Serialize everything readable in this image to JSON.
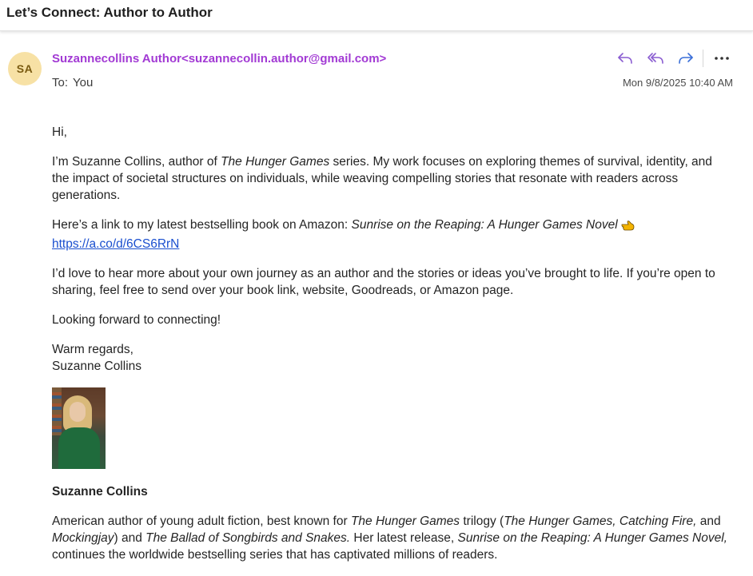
{
  "subject": "Let’s Connect: Author to Author",
  "sender": {
    "initials": "SA",
    "display": "Suzannecollins Author<suzannecollin.author@gmail.com>"
  },
  "to": {
    "label": "To:",
    "value": "You"
  },
  "timestamp": "Mon 9/8/2025 10:40 AM",
  "colors": {
    "sender": "#a23ad4",
    "link": "#1a4fcf",
    "action_icons": "#8a5cd1",
    "avatar_bg": "#f7e1a5"
  },
  "actions": [
    {
      "name": "reply-icon"
    },
    {
      "name": "reply-all-icon"
    },
    {
      "name": "forward-icon"
    },
    {
      "name": "more-icon"
    }
  ],
  "body": {
    "greeting": "Hi,",
    "p1_a": "I’m Suzanne Collins, author of ",
    "p1_b": "The Hunger Games",
    "p1_c": " series. My work focuses on exploring themes of survival, identity, and the impact of societal structures on individuals, while weaving compelling stories that resonate with readers across generations.",
    "p2_a": "Here’s a link to my latest bestselling book on Amazon: ",
    "p2_b": "Sunrise on the Reaping: A Hunger Games Novel",
    "link": "https://a.co/d/6CS6RrN",
    "p3": "I’d love to hear more about your own journey as an author and the stories or ideas you’ve brought to life. If you’re open to sharing, feel free to send over your book link, website, Goodreads, or Amazon page.",
    "p4": "Looking forward to connecting!",
    "closing": "Warm regards,",
    "closing_name": "Suzanne Collins"
  },
  "signature": {
    "name": "Suzanne Collins",
    "bio_a": "American author of young adult fiction, best known for ",
    "bio_b": "The Hunger Games",
    "bio_c": " trilogy (",
    "bio_d": "The Hunger Games, Catching Fire,",
    "bio_e": " and ",
    "bio_f": "Mockingjay",
    "bio_g": ") and ",
    "bio_h": "The Ballad of Songbirds and Snakes.",
    "bio_i": " Her latest release, ",
    "bio_j": "Sunrise on the Reaping: A Hunger Games Novel,",
    "bio_k": " continues the worldwide bestselling series that has captivated millions of readers."
  }
}
